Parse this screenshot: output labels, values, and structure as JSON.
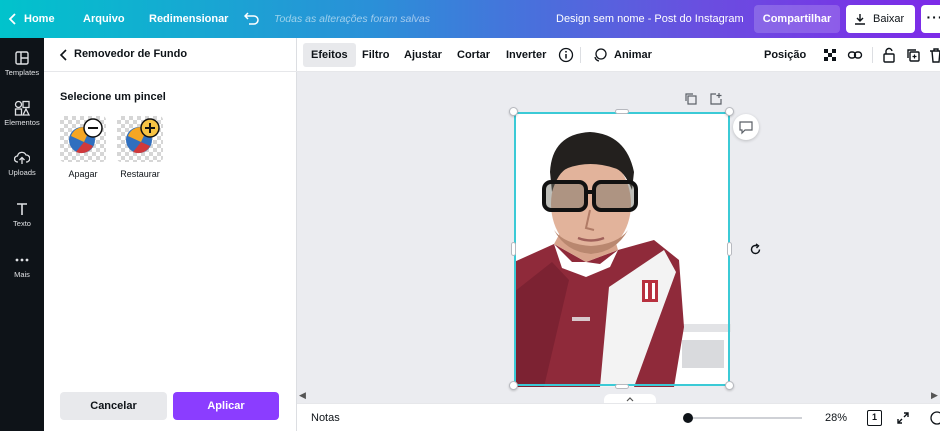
{
  "topbar": {
    "home": "Home",
    "file": "Arquivo",
    "resize": "Redimensionar",
    "status": "Todas as alterações foram salvas",
    "design_name": "Design sem nome - Post do Instagram",
    "share": "Compartilhar",
    "download": "Baixar",
    "more": "···"
  },
  "rail": {
    "items": [
      {
        "label": "Templates",
        "icon": "templates-icon"
      },
      {
        "label": "Elementos",
        "icon": "elements-icon"
      },
      {
        "label": "Uploads",
        "icon": "upload-icon"
      },
      {
        "label": "Texto",
        "icon": "text-icon"
      },
      {
        "label": "Mais",
        "icon": "more-dots-icon"
      }
    ]
  },
  "panel": {
    "title": "Removedor de Fundo",
    "section": "Selecione um pincel",
    "brushes": [
      {
        "label": "Apagar",
        "icon": "erase-brush-icon"
      },
      {
        "label": "Restaurar",
        "icon": "restore-brush-icon"
      }
    ],
    "cancel": "Cancelar",
    "apply": "Aplicar"
  },
  "toolbar": {
    "effects": "Efeitos",
    "filter": "Filtro",
    "adjust": "Ajustar",
    "crop": "Cortar",
    "flip": "Inverter",
    "animate": "Animar",
    "position": "Posição"
  },
  "bottombar": {
    "notes": "Notas",
    "zoom": "28%",
    "zoom_level": 0.28,
    "page_count": "1"
  },
  "colors": {
    "accent": "#8b3dff",
    "selection": "#3bcad6",
    "rail_bg": "#0e1318",
    "canvas_bg": "#ebecf0"
  }
}
